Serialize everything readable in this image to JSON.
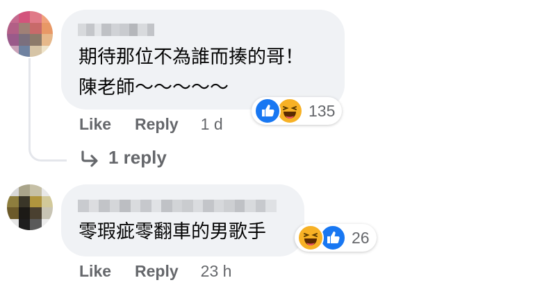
{
  "comments": [
    {
      "author_blurred": true,
      "text_line1": "期待那位不為誰而揍的哥！",
      "text_line2": "陳老師～～～～～",
      "like_label": "Like",
      "reply_label": "Reply",
      "time": "1 d",
      "reaction_count": "135",
      "reaction_icons": [
        "like-icon",
        "haha-icon"
      ],
      "replies_link": "1 reply"
    },
    {
      "author_blurred": true,
      "text_line1": "零瑕疵零翻車的男歌手",
      "like_label": "Like",
      "reply_label": "Reply",
      "time": "23 h",
      "reaction_count": "26",
      "reaction_icons": [
        "haha-icon",
        "like-icon"
      ]
    }
  ],
  "colors": {
    "bubble": "#f0f2f5",
    "meta_text": "#65676b",
    "like_blue": "#1877f2",
    "haha_yellow": "#f7b125"
  }
}
